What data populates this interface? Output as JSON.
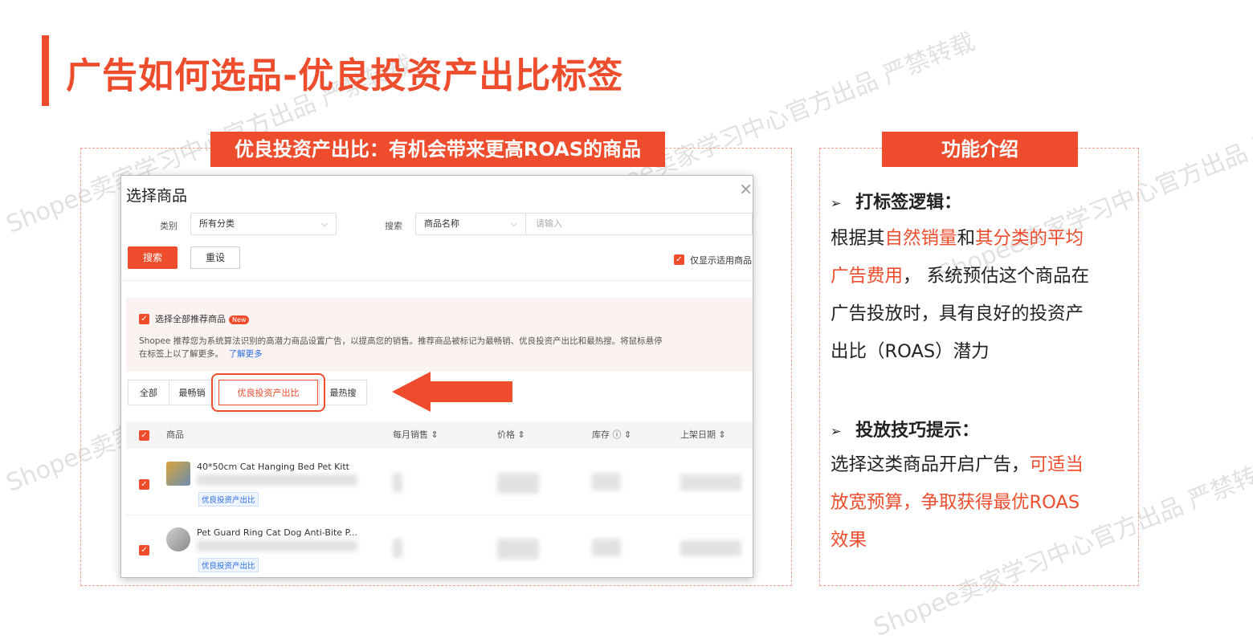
{
  "page_title": "广告如何选品-优良投资产出比标签",
  "left_banner": "优良投资产出比：有机会带来更高ROAS的商品",
  "right_banner": "功能介绍",
  "modal": {
    "title": "选择商品",
    "close": "×",
    "category_label": "类别",
    "category_value": "所有分类",
    "search_label": "搜索",
    "search_field_value": "商品名称",
    "search_placeholder": "请输入",
    "search_button": "搜索",
    "reset_button": "重设",
    "only_applicable": "仅显示适用商品",
    "select_all_recommended": "选择全部推荐商品",
    "new_badge": "New",
    "rec_desc_1": "Shopee 推荐您为系统算法识别的高潜力商品设置广告，以提高您的销售。推荐商品被标记为最畅销、优良投资产出比和最热搜。将鼠标悬停",
    "rec_desc_2": "在标签上以了解更多。",
    "learn_more": "了解更多",
    "tabs": [
      "全部",
      "最畅销",
      "优良投资产出比",
      "最热搜"
    ],
    "columns": [
      "商品",
      "每月销售 ⇕",
      "价格 ⇕",
      "库存 ⓘ ⇕",
      "上架日期 ⇕"
    ],
    "rows": [
      {
        "name": "40*50cm Cat Hanging Bed Pet Kitt",
        "tag": "优良投资产出比"
      },
      {
        "name": "Pet Guard Ring Cat Dog Anti-Bite P...",
        "tag": "优良投资产出比"
      }
    ]
  },
  "intro": {
    "section1_title": "打标签逻辑：",
    "s1_a": "根据其",
    "s1_b": "自然销量",
    "s1_c": "和",
    "s1_d": "其分类的平均",
    "s1_e": "广告费用",
    "s1_f": "， 系统预估这个商品在",
    "s1_g": "广告投放时，具有良好的投资产",
    "s1_h": "出比（ROAS）潜力",
    "section2_title": "投放技巧提示：",
    "s2_a": "选择这类商品开启广告，",
    "s2_b": "可适当",
    "s2_c": "放宽预算，争取获得最优ROAS",
    "s2_d": "效果",
    "bullet": "➢"
  },
  "watermark": "Shopee卖家学习中心官方出品 严禁转载",
  "colors": {
    "accent": "#ee4d2d",
    "link": "#2a6ee8"
  }
}
